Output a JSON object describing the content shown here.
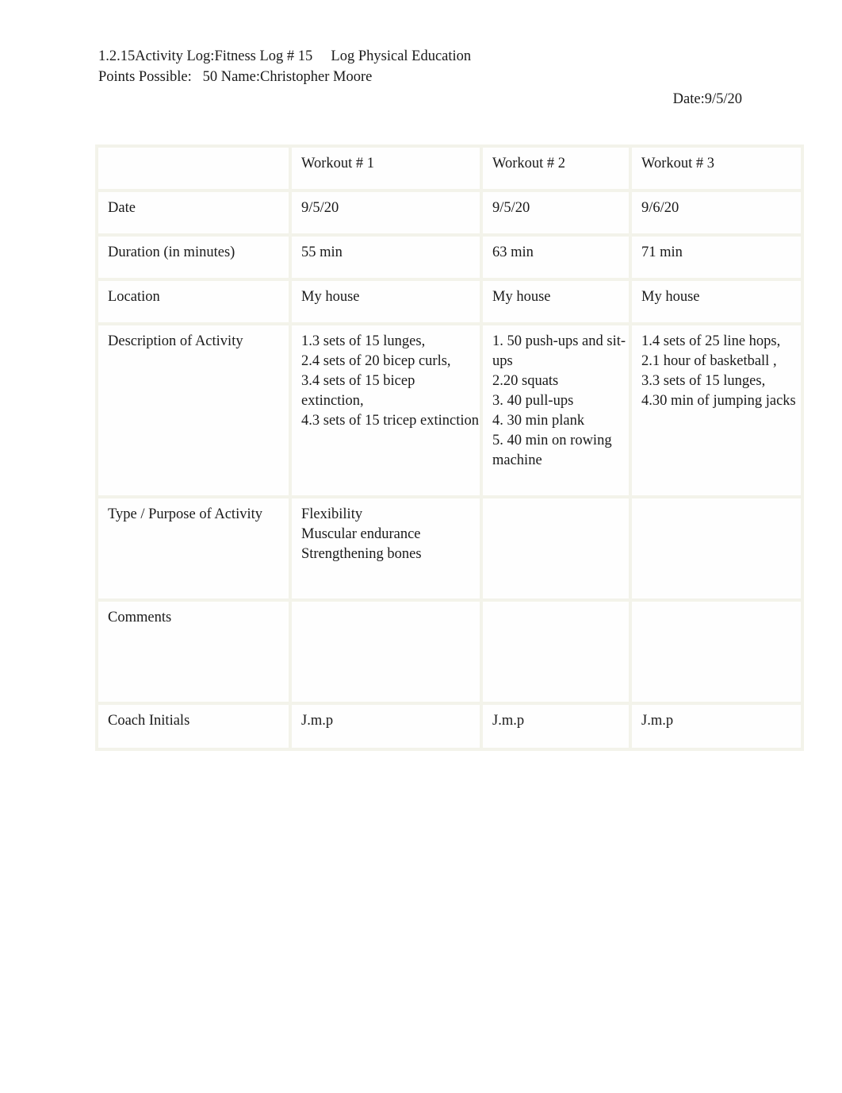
{
  "document": {
    "header": {
      "line1": "1.2.15Activity Log:Fitness Log # 15     Log Physical Education",
      "line2": "Points Possible:   50 Name:Christopher Moore",
      "date_line": "Date:9/5/20"
    },
    "table": {
      "column_headers": [
        "",
        "Workout # 1",
        "Workout # 2",
        "Workout # 3"
      ],
      "rows": [
        {
          "label": "Date",
          "workout1": "9/5/20",
          "workout2": "9/5/20",
          "workout3": "9/6/20"
        },
        {
          "label": "Duration (in minutes)",
          "workout1": "55 min",
          "workout2": "63 min",
          "workout3": "71 min"
        },
        {
          "label": "Location",
          "workout1": " My house",
          "workout2": " My house",
          "workout3": " My house"
        },
        {
          "label": "Description of Activity",
          "workout1": "1.3 sets of 15 lunges,\n2.4 sets of 20 bicep curls,\n3.4 sets of 15 bicep extinction,\n4.3 sets of 15 tricep extinction",
          "workout2": "1. 50 push-ups and sit-ups\n 2.20 squats\n3. 40 pull-ups\n4. 30 min plank\n5. 40 min on rowing machine",
          "workout3": "1.4 sets of 25 line hops,\n2.1 hour of basketball  ,\n3.3 sets of 15 lunges,\n4.30 min of jumping jacks"
        },
        {
          "label": "Type / Purpose of Activity",
          "workout1": " Flexibility\nMuscular endurance\nStrengthening bones",
          "workout2": "",
          "workout3": ""
        },
        {
          "label": "Comments",
          "workout1": "",
          "workout2": "",
          "workout3": ""
        },
        {
          "label": "Coach Initials",
          "workout1": " J.m.p",
          "workout2": "J.m.p",
          "workout3": "J.m.p"
        }
      ]
    }
  },
  "colors": {
    "page_background": "#ffffff",
    "text": "#1a1a1a",
    "table_border": "#f3f3ea",
    "cell_background": "#fefefe"
  }
}
